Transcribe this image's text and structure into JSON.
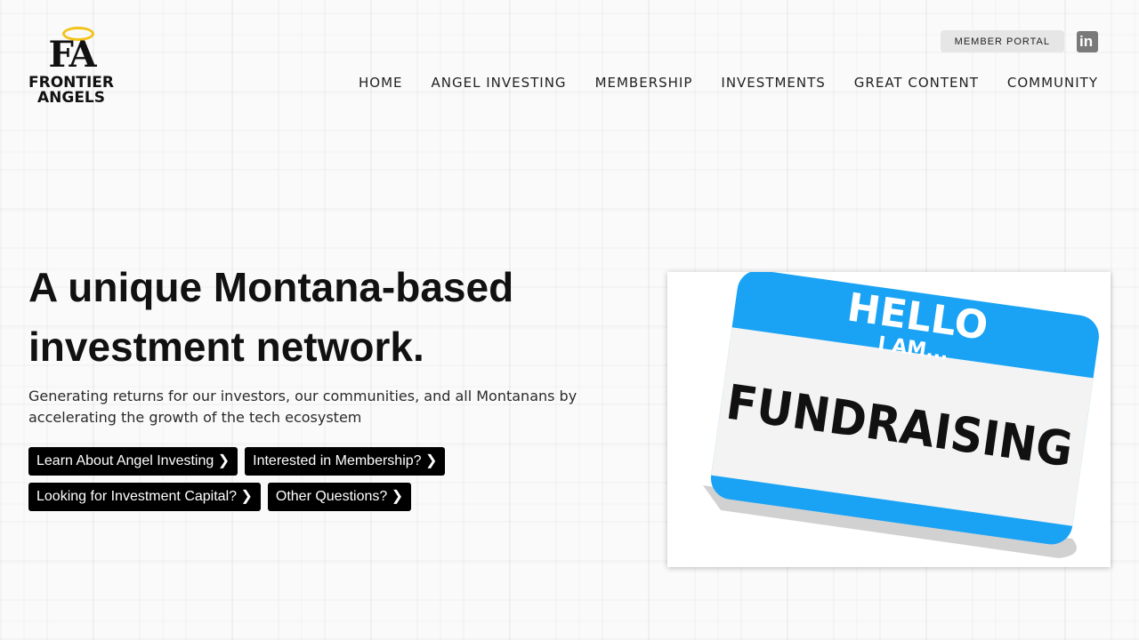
{
  "logo": {
    "initials": "FA",
    "line1": "FRONTIER",
    "line2": "ANGELS"
  },
  "utility": {
    "member_portal_label": "MEMBER PORTAL",
    "linkedin_icon": "linkedin-icon"
  },
  "nav": {
    "items": [
      "HOME",
      "ANGEL INVESTING",
      "MEMBERSHIP",
      "INVESTMENTS",
      "GREAT CONTENT",
      "COMMUNITY"
    ]
  },
  "hero": {
    "title_line1": "A unique Montana-based",
    "title_line2": "investment network.",
    "subtitle": "Generating returns for our investors, our communities, and all Montanans by accelerating the growth of the tech ecosystem",
    "buttons": [
      "Learn About Angel Investing ❯",
      "Interested in Membership? ❯",
      "Looking for Investment Capital? ❯",
      "Other Questions? ❯"
    ]
  },
  "image": {
    "tag_hello": "HELLO",
    "tag_iam": "I AM...",
    "tag_word": "FUNDRAISING"
  },
  "colors": {
    "accent_halo": "#f2c318",
    "tag_blue": "#1aa3f5",
    "button_bg": "#000000"
  }
}
